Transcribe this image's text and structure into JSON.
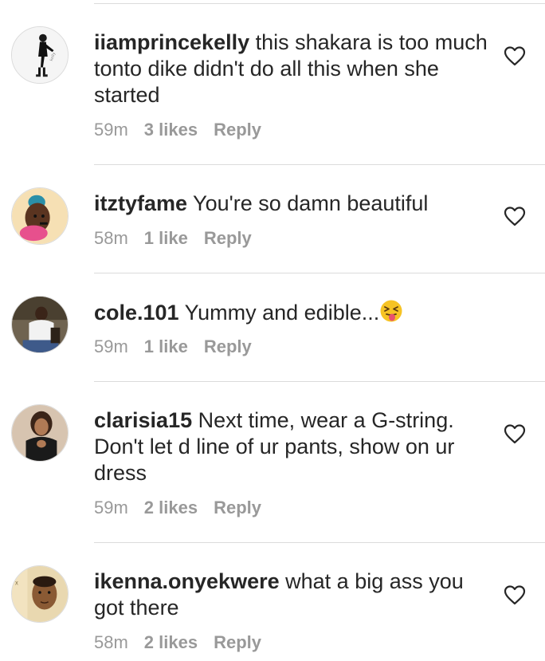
{
  "comments": [
    {
      "username": "iiamprincekelly",
      "text": "this shakara is too much tonto dike didn't do all this when she started",
      "time": "59m",
      "likes": "3 likes",
      "reply": "Reply",
      "avatar_color": "#e8e8e8"
    },
    {
      "username": "itztyfame",
      "text": "You're so damn beautiful",
      "time": "58m",
      "likes": "1 like",
      "reply": "Reply",
      "avatar_color": "#f3d9a8"
    },
    {
      "username": "cole.101",
      "text": "Yummy and edible...",
      "emoji": "squinting-tongue-face-emoji",
      "time": "59m",
      "likes": "1 like",
      "reply": "Reply",
      "avatar_color": "#8a7a62"
    },
    {
      "username": "clarisia15",
      "text": "Next time, wear a G-string. Don't let d line of ur pants, show on ur dress",
      "time": "59m",
      "likes": "2 likes",
      "reply": "Reply",
      "avatar_color": "#c9a48a"
    },
    {
      "username": "ikenna.onyekwere",
      "text": "what a big ass you got there",
      "time": "58m",
      "likes": "2 likes",
      "reply": "Reply",
      "avatar_color": "#b58a5c"
    }
  ],
  "icons": {
    "like": "heart-outline-icon"
  },
  "colors": {
    "text": "#262626",
    "meta": "#999999",
    "divider": "#dbdbdb",
    "heart": "#262626"
  }
}
